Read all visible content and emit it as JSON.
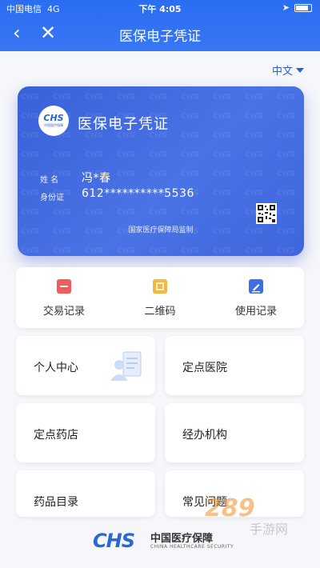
{
  "status_bar": {
    "carrier": "中国电信",
    "network": "4G",
    "time": "下午 4:05"
  },
  "nav": {
    "back_icon": "chevron-left-icon",
    "close_icon": "close-icon",
    "title": "医保电子凭证"
  },
  "lang": {
    "label": "中文"
  },
  "card": {
    "logo_text": "CHS",
    "logo_sub": "中国医疗保障",
    "title": "医保电子凭证",
    "name_label": "姓  名",
    "name_value": "冯*春",
    "id_label": "身份证",
    "id_value": "612**********5536",
    "footer": "国家医疗保障局监制"
  },
  "actions": [
    {
      "label": "交易记录",
      "icon": "transaction-record-icon",
      "color": "#f15b5b"
    },
    {
      "label": "二维码",
      "icon": "qrcode-icon",
      "color": "#f6b73c"
    },
    {
      "label": "使用记录",
      "icon": "usage-record-icon",
      "color": "#3d6ee6"
    }
  ],
  "tiles": [
    {
      "label": "个人中心"
    },
    {
      "label": "定点医院"
    },
    {
      "label": "定点药店"
    },
    {
      "label": "经办机构"
    },
    {
      "label": "药品目录"
    },
    {
      "label": "常见问题"
    }
  ],
  "bottom": {
    "chs": "CHS",
    "cn": "中国医疗保障",
    "en": "CHINA HEALTHCARE SECURITY"
  },
  "watermark": {
    "brand": "289",
    "site": "手游网"
  },
  "colors": {
    "primary": "#2a6df1",
    "card": "#4169e0"
  }
}
